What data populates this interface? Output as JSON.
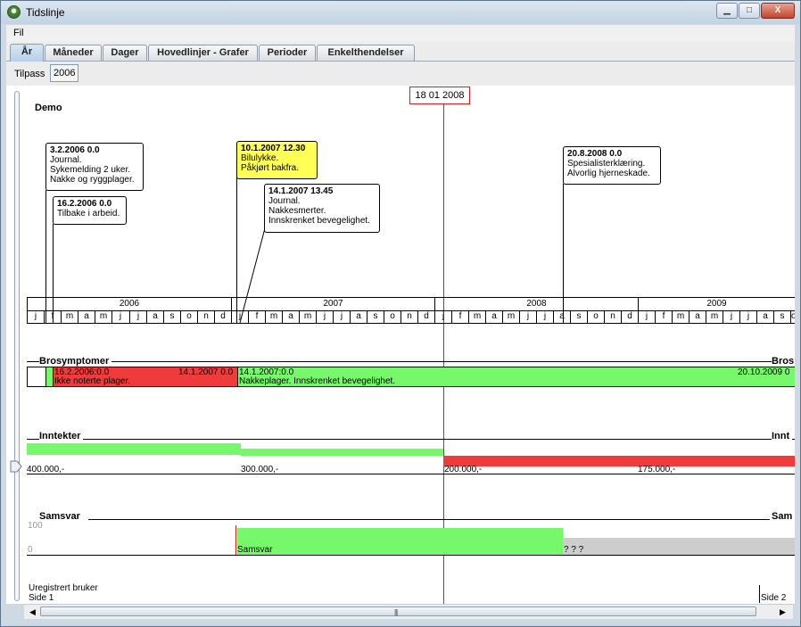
{
  "window": {
    "title": "Tidslinje",
    "min_label": "▁",
    "max_label": "□",
    "close_label": "X"
  },
  "menu": {
    "file": "Fil"
  },
  "tabs": [
    "År",
    "Måneder",
    "Dager",
    "Hovedlinjer - Grafer",
    "Perioder",
    "Enkelthendelser"
  ],
  "active_tab": "År",
  "toolbar": {
    "fit_label": "Tilpass",
    "year_value": "2006"
  },
  "timeline": {
    "heading": "Demo",
    "cursor_date": "18 01 2008",
    "years": [
      "2006",
      "2007",
      "2008",
      "2009"
    ],
    "month_letters": [
      "j",
      "f",
      "m",
      "a",
      "m",
      "j",
      "j",
      "a",
      "s",
      "o",
      "n",
      "d"
    ],
    "events": [
      {
        "date": "3.2.2006 0.0",
        "lines": [
          "Journal.",
          "Sykemelding 2 uker.",
          "Nakke og ryggplager."
        ]
      },
      {
        "date": "16.2.2006 0.0",
        "lines": [
          "Tilbake i arbeid."
        ]
      },
      {
        "date": "10.1.2007 12.30",
        "lines": [
          "Bilulykke.",
          "Påkjørt bakfra."
        ],
        "highlight": true
      },
      {
        "date": "14.1.2007 13.45",
        "lines": [
          "Journal.",
          "Nakkesmerter.",
          "Innskrenket bevegelighet."
        ]
      },
      {
        "date": "20.8.2008 0.0",
        "lines": [
          "Spesialisterklæring.",
          "Alvorlig hjerneskade."
        ]
      }
    ]
  },
  "brosymptomer": {
    "title": "Brosymptomer",
    "title_cut": "Bros",
    "seg1_start": "16.2.2006:0.0",
    "seg1_text": "Ikke noterte plager.",
    "seg1_end": "14.1.2007 0.0",
    "seg2_start": "14.1.2007:0.0",
    "seg2_text": "Nakkeplager. Innskrenket bevegelighet.",
    "seg2_end": "20.10.2009 0",
    "colors": {
      "red": "#ef3b3b",
      "green": "#77f76a"
    }
  },
  "inntekter": {
    "title": "Inntekter",
    "title_cut": "Innt",
    "values": [
      "400.000,-",
      "300.000,-",
      "200.000,-",
      "175.000,-"
    ]
  },
  "samsvar": {
    "title": "Samsvar",
    "title_cut": "Sam",
    "axis_top": "100",
    "axis_bottom": "0",
    "label": "Samsvar",
    "unknown": "? ? ?"
  },
  "footer": {
    "user": "Uregistrert bruker",
    "page1": "Side 1",
    "page2": "Side 2"
  },
  "scrollbar": {
    "left": "◀",
    "right": "▶",
    "grip": "|||"
  }
}
